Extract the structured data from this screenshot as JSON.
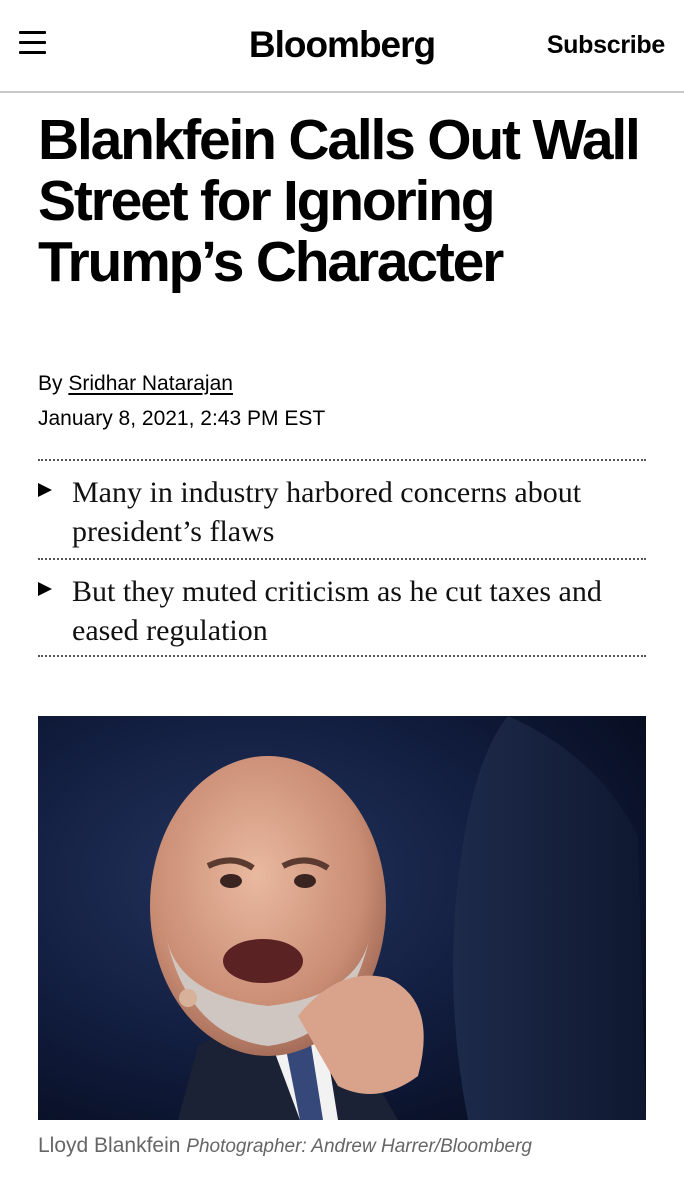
{
  "header": {
    "brand": "Bloomberg",
    "subscribe_label": "Subscribe",
    "menu_icon": "hamburger-menu-icon"
  },
  "article": {
    "headline": "Blankfein Calls Out Wall Street for Ignoring Trump’s Character",
    "byline_prefix": "By",
    "author": "Sridhar Natarajan",
    "date": "January 8, 2021, 2:43 PM EST",
    "bullets": [
      "Many in industry harbored concerns about president’s flaws",
      "But they muted criticism as he cut taxes and eased regulation"
    ],
    "photo": {
      "caption": "Lloyd Blankfein",
      "credit": "Photographer: Andrew Harrer/Bloomberg"
    }
  },
  "colors": {
    "text": "#000000",
    "caption": "#666666",
    "photo_background": "#0c1530",
    "divider": "#c8c8c8"
  }
}
